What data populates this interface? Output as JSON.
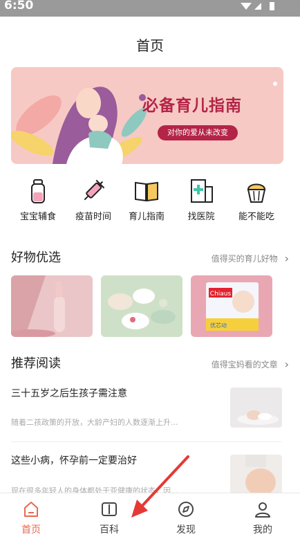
{
  "status_bar": {
    "time": "6:50"
  },
  "page": {
    "title": "首页"
  },
  "banner": {
    "headline": "必备育儿指南",
    "subtitle": "对你的爱从未改变"
  },
  "quick_links": [
    {
      "label": "宝宝辅食",
      "icon": "baby-bottle-icon"
    },
    {
      "label": "疫苗时间",
      "icon": "syringe-icon"
    },
    {
      "label": "育儿指南",
      "icon": "book-icon"
    },
    {
      "label": "找医院",
      "icon": "hospital-icon"
    },
    {
      "label": "能不能吃",
      "icon": "cupcake-icon"
    }
  ],
  "goods": {
    "title": "好物优选",
    "more": "值得买的育儿好物",
    "items": [
      {
        "name": "baby-spoon-feeder"
      },
      {
        "name": "baby-shoes"
      },
      {
        "name": "diapers",
        "brand": "Chiaus",
        "tagline": "优芯动"
      }
    ]
  },
  "reading": {
    "title": "推荐阅读",
    "more": "值得宝妈看的文章",
    "articles": [
      {
        "title": "三十五岁之后生孩子需注意",
        "desc": "随着二孩政策的开放，大龄产妇的人数逐渐上升..."
      },
      {
        "title": "这些小病，怀孕前一定要治好",
        "desc": "现在很多年轻人的身体都处于亚健康的状态，因..."
      }
    ]
  },
  "tabbar": [
    {
      "label": "首页",
      "icon": "home-icon",
      "active": true
    },
    {
      "label": "百科",
      "icon": "encyclopedia-icon",
      "active": false
    },
    {
      "label": "发现",
      "icon": "compass-icon",
      "active": false
    },
    {
      "label": "我的",
      "icon": "profile-icon",
      "active": false
    }
  ],
  "colors": {
    "accent": "#e8684f",
    "banner_bg": "#f7c9c4",
    "banner_text": "#b32447",
    "annotation_arrow": "#e53935"
  }
}
